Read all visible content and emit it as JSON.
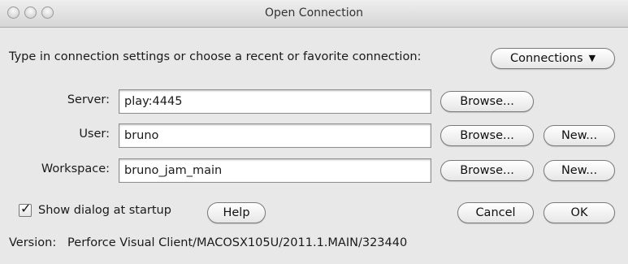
{
  "window": {
    "title": "Open Connection"
  },
  "prompt": "Type in connection settings or choose a recent or favorite connection:",
  "connections_button": {
    "label": "Connections",
    "icon": "chevron-down-icon"
  },
  "fields": {
    "server": {
      "label": "Server:",
      "value": "play:4445"
    },
    "user": {
      "label": "User:",
      "value": "bruno"
    },
    "workspace": {
      "label": "Workspace:",
      "value": "bruno_jam_main"
    }
  },
  "buttons": {
    "browse": "Browse...",
    "new": "New...",
    "help": "Help",
    "cancel": "Cancel",
    "ok": "OK"
  },
  "startup_checkbox": {
    "label": "Show dialog at startup",
    "checked": true
  },
  "version": {
    "label": "Version:",
    "value": "Perforce Visual Client/MACOSX105U/2011.1.MAIN/323440"
  }
}
